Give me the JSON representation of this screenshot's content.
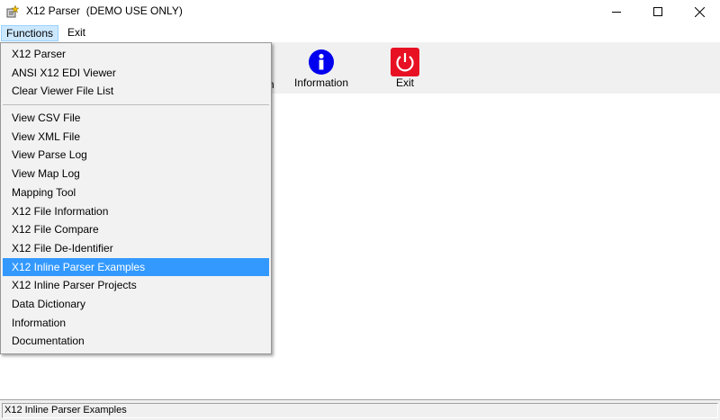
{
  "window": {
    "title": "X12 Parser  (DEMO USE ONLY)",
    "minimize_icon": "minimize-icon",
    "maximize_icon": "maximize-icon",
    "close_icon": "close-icon",
    "app_icon": "app-icon"
  },
  "menubar": {
    "functions_label": "Functions",
    "exit_label": "Exit"
  },
  "toolbar": {
    "partial_label": "n",
    "information_label": "Information",
    "information_icon": "info-icon",
    "information_color": "#0000ee",
    "exit_label": "Exit",
    "exit_icon": "power-icon",
    "exit_color": "#e81123"
  },
  "functions_menu": {
    "items": [
      "X12 Parser",
      "ANSI X12 EDI Viewer",
      "Clear Viewer File List",
      "View CSV File",
      "View XML File",
      "View Parse Log",
      "View Map Log",
      "Mapping Tool",
      "X12 File Information",
      "X12 File Compare",
      "X12 File De-Identifier",
      "X12 Inline Parser Examples",
      "X12 Inline Parser Projects",
      "Data Dictionary",
      "Information",
      "Documentation"
    ],
    "selected": "X12 Inline Parser Examples",
    "highlight_color": "#3399ff"
  },
  "statusbar": {
    "text": "X12 Inline Parser Examples"
  }
}
